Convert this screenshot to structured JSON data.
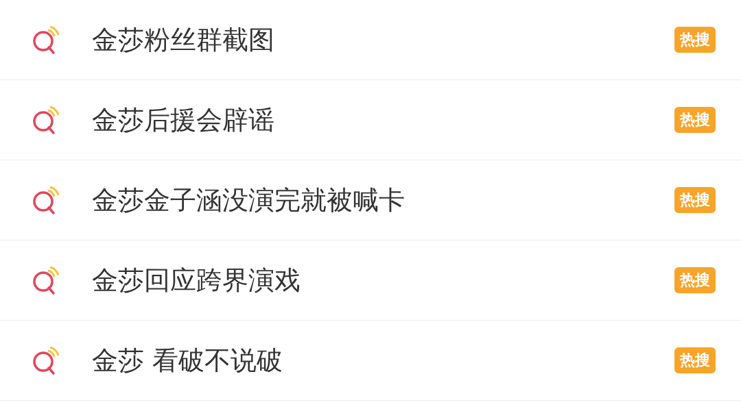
{
  "items": [
    {
      "text": "金莎粉丝群截图",
      "badge": "热搜"
    },
    {
      "text": "金莎后援会辟谣",
      "badge": "热搜"
    },
    {
      "text": "金莎金子涵没演完就被喊卡",
      "badge": "热搜"
    },
    {
      "text": "金莎回应跨界演戏",
      "badge": "热搜"
    },
    {
      "text": "金莎 看破不说破",
      "badge": "热搜"
    }
  ]
}
